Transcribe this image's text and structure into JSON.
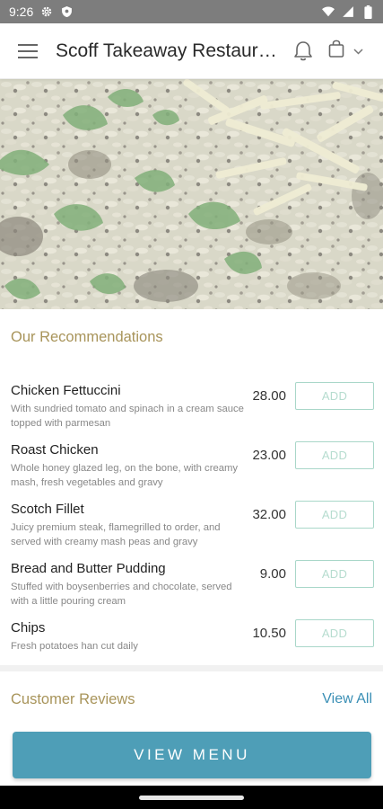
{
  "status_bar": {
    "time": "9:26",
    "icons": [
      "settings-icon",
      "shield-icon",
      "wifi-icon",
      "signal-icon",
      "battery-icon"
    ]
  },
  "app_bar": {
    "title": "Scoff Takeaway Restaurant",
    "icons": [
      "hamburger-menu-icon",
      "bell-icon",
      "shopping-bag-icon",
      "chevron-down-icon"
    ]
  },
  "hero": {
    "alt": "risotto-with-herbs-and-parmesan"
  },
  "recommendations": {
    "title": "Our Recommendations",
    "add_label": "ADD",
    "items": [
      {
        "name": "Chicken Fettuccini",
        "description": "With sundried tomato and spinach in a cream sauce topped with parmesan",
        "price": "28.00"
      },
      {
        "name": "Roast Chicken",
        "description": "Whole honey glazed leg, on the bone, with creamy mash, fresh vegetables and gravy",
        "price": "23.00"
      },
      {
        "name": "Scotch Fillet",
        "description": "Juicy premium steak, flamegrilled to order, and served with creamy mash peas and gravy",
        "price": "32.00"
      },
      {
        "name": "Bread and Butter Pudding",
        "description": "Stuffed with boysenberries and chocolate, served with a little pouring cream",
        "price": "9.00"
      },
      {
        "name": "Chips",
        "description": "Fresh potatoes han cut daily",
        "price": "10.50"
      }
    ]
  },
  "reviews": {
    "title": "Customer Reviews",
    "view_all_label": "View All"
  },
  "footer": {
    "view_menu_label": "VIEW MENU"
  },
  "colors": {
    "accent_gold": "#a8945a",
    "accent_blue": "#4e9eb7",
    "add_green": "#a9d7c9",
    "link_blue": "#3a8fb5"
  }
}
